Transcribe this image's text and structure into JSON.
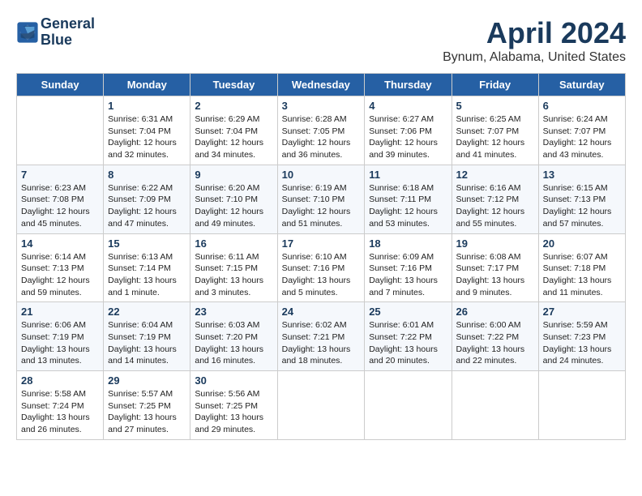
{
  "header": {
    "logo_line1": "General",
    "logo_line2": "Blue",
    "month_title": "April 2024",
    "location": "Bynum, Alabama, United States"
  },
  "weekdays": [
    "Sunday",
    "Monday",
    "Tuesday",
    "Wednesday",
    "Thursday",
    "Friday",
    "Saturday"
  ],
  "weeks": [
    [
      {
        "day": "",
        "info": ""
      },
      {
        "day": "1",
        "info": "Sunrise: 6:31 AM\nSunset: 7:04 PM\nDaylight: 12 hours\nand 32 minutes."
      },
      {
        "day": "2",
        "info": "Sunrise: 6:29 AM\nSunset: 7:04 PM\nDaylight: 12 hours\nand 34 minutes."
      },
      {
        "day": "3",
        "info": "Sunrise: 6:28 AM\nSunset: 7:05 PM\nDaylight: 12 hours\nand 36 minutes."
      },
      {
        "day": "4",
        "info": "Sunrise: 6:27 AM\nSunset: 7:06 PM\nDaylight: 12 hours\nand 39 minutes."
      },
      {
        "day": "5",
        "info": "Sunrise: 6:25 AM\nSunset: 7:07 PM\nDaylight: 12 hours\nand 41 minutes."
      },
      {
        "day": "6",
        "info": "Sunrise: 6:24 AM\nSunset: 7:07 PM\nDaylight: 12 hours\nand 43 minutes."
      }
    ],
    [
      {
        "day": "7",
        "info": "Sunrise: 6:23 AM\nSunset: 7:08 PM\nDaylight: 12 hours\nand 45 minutes."
      },
      {
        "day": "8",
        "info": "Sunrise: 6:22 AM\nSunset: 7:09 PM\nDaylight: 12 hours\nand 47 minutes."
      },
      {
        "day": "9",
        "info": "Sunrise: 6:20 AM\nSunset: 7:10 PM\nDaylight: 12 hours\nand 49 minutes."
      },
      {
        "day": "10",
        "info": "Sunrise: 6:19 AM\nSunset: 7:10 PM\nDaylight: 12 hours\nand 51 minutes."
      },
      {
        "day": "11",
        "info": "Sunrise: 6:18 AM\nSunset: 7:11 PM\nDaylight: 12 hours\nand 53 minutes."
      },
      {
        "day": "12",
        "info": "Sunrise: 6:16 AM\nSunset: 7:12 PM\nDaylight: 12 hours\nand 55 minutes."
      },
      {
        "day": "13",
        "info": "Sunrise: 6:15 AM\nSunset: 7:13 PM\nDaylight: 12 hours\nand 57 minutes."
      }
    ],
    [
      {
        "day": "14",
        "info": "Sunrise: 6:14 AM\nSunset: 7:13 PM\nDaylight: 12 hours\nand 59 minutes."
      },
      {
        "day": "15",
        "info": "Sunrise: 6:13 AM\nSunset: 7:14 PM\nDaylight: 13 hours\nand 1 minute."
      },
      {
        "day": "16",
        "info": "Sunrise: 6:11 AM\nSunset: 7:15 PM\nDaylight: 13 hours\nand 3 minutes."
      },
      {
        "day": "17",
        "info": "Sunrise: 6:10 AM\nSunset: 7:16 PM\nDaylight: 13 hours\nand 5 minutes."
      },
      {
        "day": "18",
        "info": "Sunrise: 6:09 AM\nSunset: 7:16 PM\nDaylight: 13 hours\nand 7 minutes."
      },
      {
        "day": "19",
        "info": "Sunrise: 6:08 AM\nSunset: 7:17 PM\nDaylight: 13 hours\nand 9 minutes."
      },
      {
        "day": "20",
        "info": "Sunrise: 6:07 AM\nSunset: 7:18 PM\nDaylight: 13 hours\nand 11 minutes."
      }
    ],
    [
      {
        "day": "21",
        "info": "Sunrise: 6:06 AM\nSunset: 7:19 PM\nDaylight: 13 hours\nand 13 minutes."
      },
      {
        "day": "22",
        "info": "Sunrise: 6:04 AM\nSunset: 7:19 PM\nDaylight: 13 hours\nand 14 minutes."
      },
      {
        "day": "23",
        "info": "Sunrise: 6:03 AM\nSunset: 7:20 PM\nDaylight: 13 hours\nand 16 minutes."
      },
      {
        "day": "24",
        "info": "Sunrise: 6:02 AM\nSunset: 7:21 PM\nDaylight: 13 hours\nand 18 minutes."
      },
      {
        "day": "25",
        "info": "Sunrise: 6:01 AM\nSunset: 7:22 PM\nDaylight: 13 hours\nand 20 minutes."
      },
      {
        "day": "26",
        "info": "Sunrise: 6:00 AM\nSunset: 7:22 PM\nDaylight: 13 hours\nand 22 minutes."
      },
      {
        "day": "27",
        "info": "Sunrise: 5:59 AM\nSunset: 7:23 PM\nDaylight: 13 hours\nand 24 minutes."
      }
    ],
    [
      {
        "day": "28",
        "info": "Sunrise: 5:58 AM\nSunset: 7:24 PM\nDaylight: 13 hours\nand 26 minutes."
      },
      {
        "day": "29",
        "info": "Sunrise: 5:57 AM\nSunset: 7:25 PM\nDaylight: 13 hours\nand 27 minutes."
      },
      {
        "day": "30",
        "info": "Sunrise: 5:56 AM\nSunset: 7:25 PM\nDaylight: 13 hours\nand 29 minutes."
      },
      {
        "day": "",
        "info": ""
      },
      {
        "day": "",
        "info": ""
      },
      {
        "day": "",
        "info": ""
      },
      {
        "day": "",
        "info": ""
      }
    ]
  ]
}
